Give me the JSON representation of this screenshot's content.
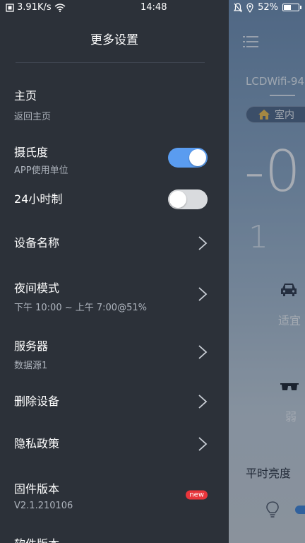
{
  "status_bar": {
    "network_speed": "3.91K/s",
    "time": "14:48",
    "battery": "52%",
    "battery_level": 0.52
  },
  "drawer": {
    "title": "更多设置",
    "items": [
      {
        "label": "主页",
        "sub": "返回主页"
      },
      {
        "label": "摄氏度",
        "sub": "APP使用单位",
        "toggle_on": true
      },
      {
        "label": "24小时制",
        "toggle_on": false
      },
      {
        "label": "设备名称"
      },
      {
        "label": "夜间模式",
        "sub": "下午 10:00 ~ 上午 7:00@51%"
      },
      {
        "label": "服务器",
        "sub": "数据源1"
      },
      {
        "label": "删除设备"
      },
      {
        "label": "隐私政策"
      },
      {
        "label": "固件版本",
        "sub": "V2.1.210106",
        "badge": "new"
      },
      {
        "label": "软件版本"
      }
    ]
  },
  "background_app": {
    "device_name": "LCDWifi-94",
    "location_label": "室内",
    "temp_partial": "-0",
    "small_partial": "1",
    "driving_label": "适宜",
    "uv_label": "弱",
    "brightness_label": "平时亮度"
  },
  "colors": {
    "toggle_on": "#5a9cf0",
    "toggle_off": "#d9dbde",
    "badge": "#e8353b",
    "drawer_bg": "#2c3139"
  }
}
